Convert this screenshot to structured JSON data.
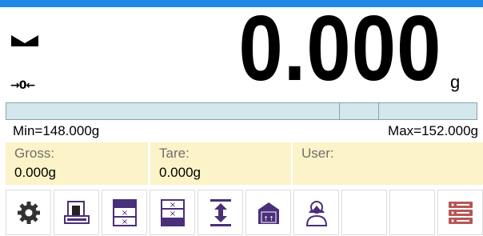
{
  "colors": {
    "accent_strip": "#1e88e5",
    "bargraph_fill": "#d3e7ec",
    "info_panel": "#fdf3c8",
    "icon_purple": "#4a2f7a",
    "icon_red": "#b85656"
  },
  "display": {
    "weight": "0.000",
    "unit": "g",
    "zero_indicator": "→0←",
    "stability_icon": "stability-indicator-icon"
  },
  "bargraph": {
    "fill_fraction": 0.0
  },
  "limits": {
    "min": "Min=148.000g",
    "max": "Max=152.000g"
  },
  "info": {
    "gross_label": "Gross:",
    "gross_value": "0.000g",
    "tare_label": "Tare:",
    "tare_value": "0.000g",
    "user_label": "User:",
    "user_value": ""
  },
  "toolbar": {
    "buttons": [
      {
        "icon": "gear-icon"
      },
      {
        "icon": "scale-print-icon"
      },
      {
        "icon": "tare-table-icon"
      },
      {
        "icon": "tare-table-2-icon"
      },
      {
        "icon": "threshold-arrows-icon"
      },
      {
        "icon": "tare-box-icon"
      },
      {
        "icon": "user-icon"
      },
      {
        "icon": "empty"
      },
      {
        "icon": "empty"
      },
      {
        "icon": "database-icon"
      }
    ]
  }
}
